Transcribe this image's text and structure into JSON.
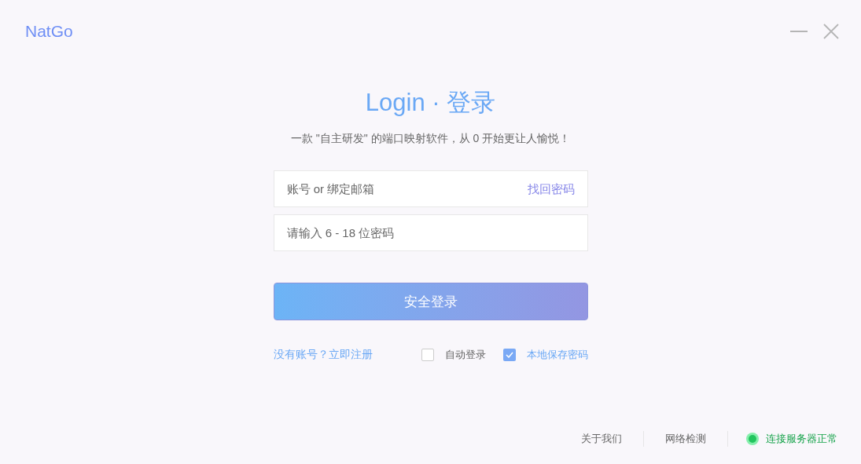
{
  "app": {
    "logo": "NatGo"
  },
  "login": {
    "title": "Login · 登录",
    "subtitle": "一款 \"自主研发\" 的端口映射软件，从 0 开始更让人愉悦！",
    "account": {
      "placeholder": "账号 or 绑定邮箱"
    },
    "forgot_link": "找回密码",
    "password": {
      "placeholder": "请输入 6 - 18 位密码"
    },
    "submit": "安全登录",
    "register_link": "没有账号？立即注册",
    "options": [
      {
        "label": "自动登录",
        "checked": false
      },
      {
        "label": "本地保存密码",
        "checked": true
      }
    ]
  },
  "footer": {
    "links": [
      "关于我们",
      "网络检测"
    ],
    "status": {
      "label": "连接服务器正常",
      "color": "#22c55e"
    }
  }
}
